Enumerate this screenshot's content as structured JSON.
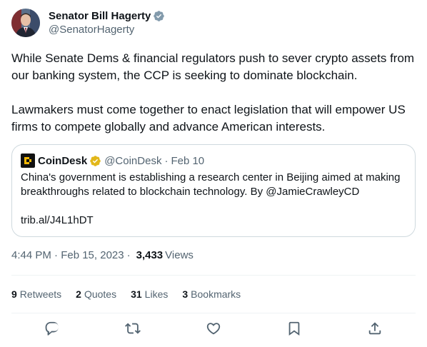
{
  "author": {
    "display_name": "Senator Bill Hagerty",
    "handle": "@SenatorHagerty",
    "verified_color": "#829aab"
  },
  "tweet": {
    "paragraphs": [
      "While Senate Dems & financial regulators push to sever crypto assets from our banking system, the CCP is seeking to dominate blockchain.",
      "Lawmakers must come together to enact legislation that will empower US firms to compete globally and advance American interests."
    ]
  },
  "quote": {
    "name": "CoinDesk",
    "handle": "@CoinDesk",
    "separator": "·",
    "date": "Feb 10",
    "text": "China's government is establishing a research center in Beijing aimed at making breakthroughs related to blockchain technology. By @JamieCrawleyCD",
    "link": "trib.al/J4L1hDT",
    "badge_color": "#e2b719"
  },
  "meta": {
    "time": "4:44 PM · Feb 15, 2023",
    "separator": "·",
    "views_count": "3,433",
    "views_label": "Views"
  },
  "stats": [
    {
      "count": "9",
      "label": "Retweets"
    },
    {
      "count": "2",
      "label": "Quotes"
    },
    {
      "count": "31",
      "label": "Likes"
    },
    {
      "count": "3",
      "label": "Bookmarks"
    }
  ],
  "actions": [
    "reply-icon",
    "retweet-icon",
    "like-icon",
    "bookmark-icon",
    "share-icon"
  ],
  "colors": {
    "text": "#0f1419",
    "secondary": "#536471",
    "border": "#cfd9de",
    "divider": "#eff3f4"
  }
}
